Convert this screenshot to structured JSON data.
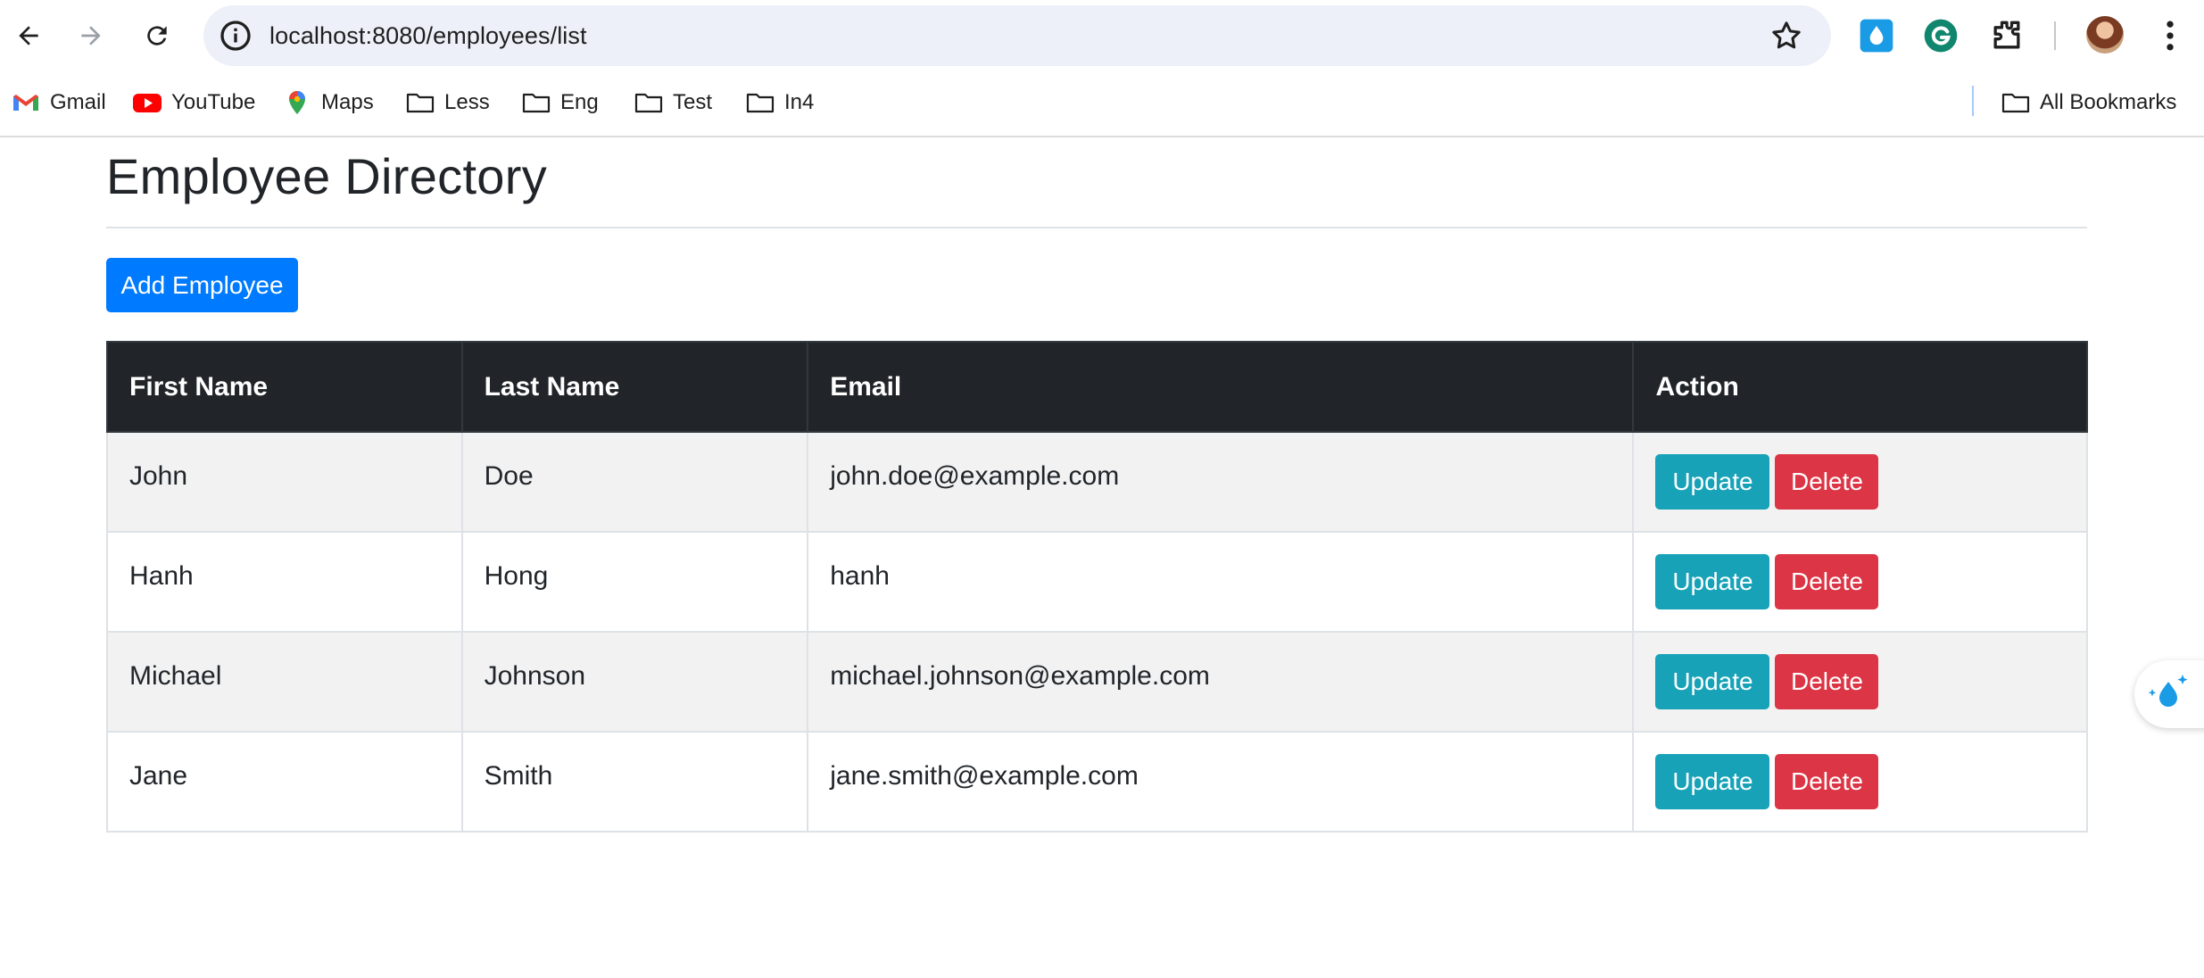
{
  "browser": {
    "url": "localhost:8080/employees/list",
    "bookmarks": [
      {
        "label": "Gmail",
        "icon": "gmail-icon"
      },
      {
        "label": "YouTube",
        "icon": "youtube-icon"
      },
      {
        "label": "Maps",
        "icon": "maps-icon"
      },
      {
        "label": "Less",
        "icon": "folder-icon"
      },
      {
        "label": "Eng",
        "icon": "folder-icon"
      },
      {
        "label": "Test",
        "icon": "folder-icon"
      },
      {
        "label": "In4",
        "icon": "folder-icon"
      }
    ],
    "all_bookmarks_label": "All Bookmarks"
  },
  "page": {
    "title": "Employee Directory",
    "add_button_label": "Add Employee",
    "table": {
      "headers": [
        "First Name",
        "Last Name",
        "Email",
        "Action"
      ],
      "rows": [
        {
          "first": "John",
          "last": "Doe",
          "email": "john.doe@example.com"
        },
        {
          "first": "Hanh",
          "last": "Hong",
          "email": "hanh"
        },
        {
          "first": "Michael",
          "last": "Johnson",
          "email": "michael.johnson@example.com"
        },
        {
          "first": "Jane",
          "last": "Smith",
          "email": "jane.smith@example.com"
        }
      ],
      "update_label": "Update",
      "delete_label": "Delete"
    }
  },
  "colors": {
    "primary": "#007bff",
    "info": "#17a2b8",
    "danger": "#dc3545",
    "table_header": "#212529",
    "stripe": "#f2f2f2"
  }
}
